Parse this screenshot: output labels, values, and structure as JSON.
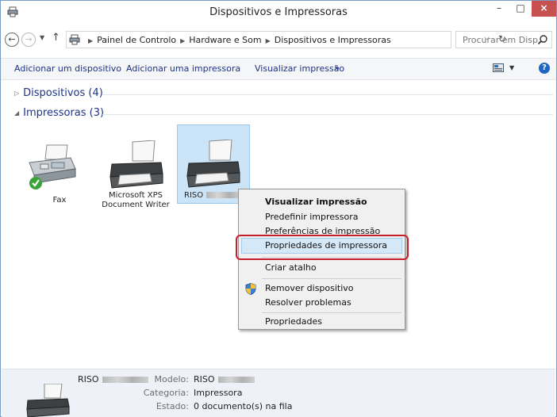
{
  "window": {
    "title": "Dispositivos e Impressoras",
    "controls": {
      "minimize": "–",
      "maximize": "□",
      "close": "×"
    }
  },
  "nav": {
    "back": "←",
    "forward": "→",
    "up": "↑"
  },
  "address": {
    "crumbs": [
      "Painel de Controlo",
      "Hardware e Som",
      "Dispositivos e Impressoras"
    ]
  },
  "search": {
    "placeholder": "Procurar em Disp..."
  },
  "commands": {
    "add_device": "Adicionar um dispositivo",
    "add_printer": "Adicionar uma impressora",
    "print_preview": "Visualizar impressão",
    "more": "»",
    "help": "?"
  },
  "groups": {
    "devices": "Dispositivos (4)",
    "printers": "Impressoras (3)"
  },
  "printers": [
    {
      "label": "Fax",
      "status": "default"
    },
    {
      "label": "Microsoft XPS Document Writer"
    },
    {
      "label": "RISO",
      "selected": true
    }
  ],
  "context_menu": {
    "items": [
      {
        "label": "Visualizar impressão",
        "bold": true
      },
      {
        "label": "Predefinir impressora"
      },
      {
        "label": "Preferências de impressão"
      },
      {
        "label": "Propriedades de impressora",
        "highlighted": true
      },
      {
        "label": "Criar atalho"
      },
      {
        "label": "Remover dispositivo",
        "icon": "shield-icon"
      },
      {
        "label": "Resolver problemas"
      },
      {
        "label": "Propriedades"
      }
    ]
  },
  "details": {
    "name": "RISO",
    "model_label": "Modelo:",
    "model_value": "RISO",
    "category_label": "Categoria:",
    "category_value": "Impressora",
    "state_label": "Estado:",
    "state_value": "0 documento(s) na fila"
  },
  "colors": {
    "highlight": "#cce4f7",
    "callout": "#c61f2c",
    "link": "#1e3287",
    "close": "#c75050"
  }
}
